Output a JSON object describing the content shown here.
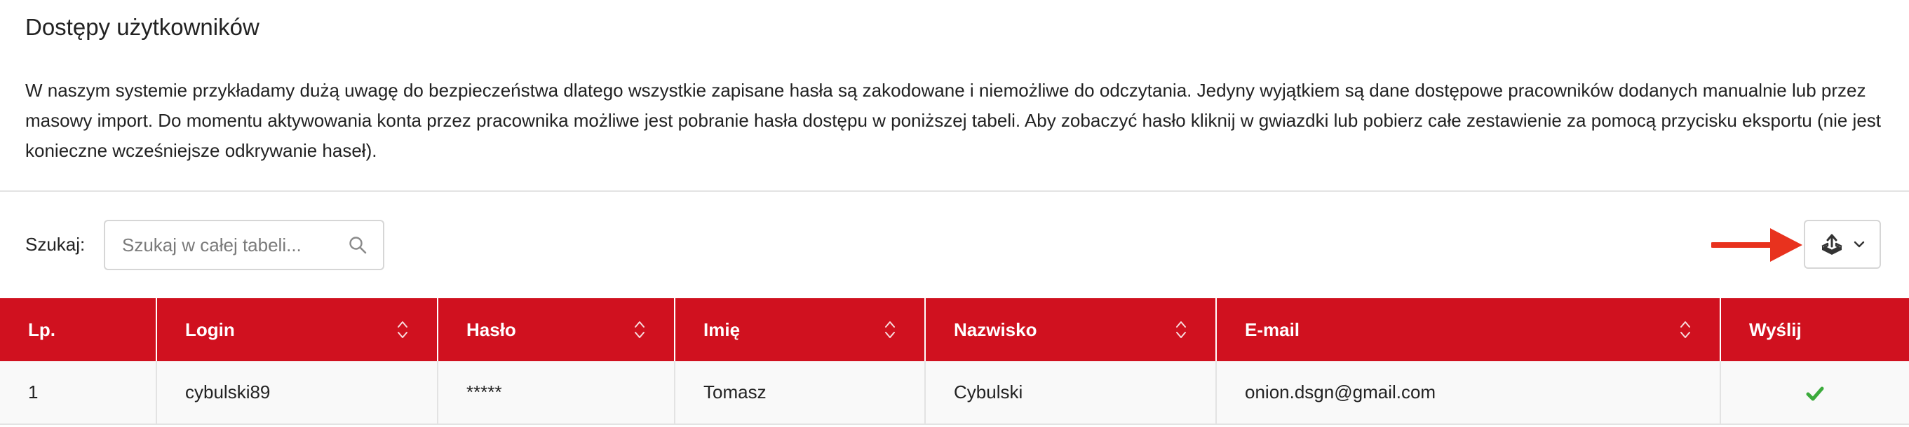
{
  "page": {
    "title": "Dostępy użytkowników",
    "description": "W naszym systemie przykładamy dużą uwagę do bezpieczeństwa dlatego wszystkie zapisane hasła są zakodowane i niemożliwe do odczytania. Jedyny wyjątkiem są dane dostępowe pracowników dodanych manualnie lub przez masowy import. Do momentu aktywowania konta przez pracownika możliwe jest pobranie hasła dostępu w poniższej tabeli. Aby zobaczyć hasło kliknij w gwiazdki lub pobierz całe zestawienie za pomocą przycisku eksportu (nie jest konieczne wcześniejsze odkrywanie haseł)."
  },
  "search": {
    "label": "Szukaj:",
    "placeholder": "Szukaj w całej tabeli...",
    "value": ""
  },
  "toolbar": {
    "export_icon": "export-icon",
    "dropdown_icon": "chevron-down-icon",
    "arrow_color": "#e8321e"
  },
  "table": {
    "header_color": "#d0111f",
    "columns": [
      "Lp.",
      "Login",
      "Hasło",
      "Imię",
      "Nazwisko",
      "E-mail",
      "Wyślij"
    ],
    "rows": [
      {
        "lp": "1",
        "login": "cybulski89",
        "password": "*****",
        "first_name": "Tomasz",
        "last_name": "Cybulski",
        "email": "onion.dsgn@gmail.com",
        "send_icon": "check-icon",
        "send_color": "#3cab3c"
      }
    ]
  }
}
